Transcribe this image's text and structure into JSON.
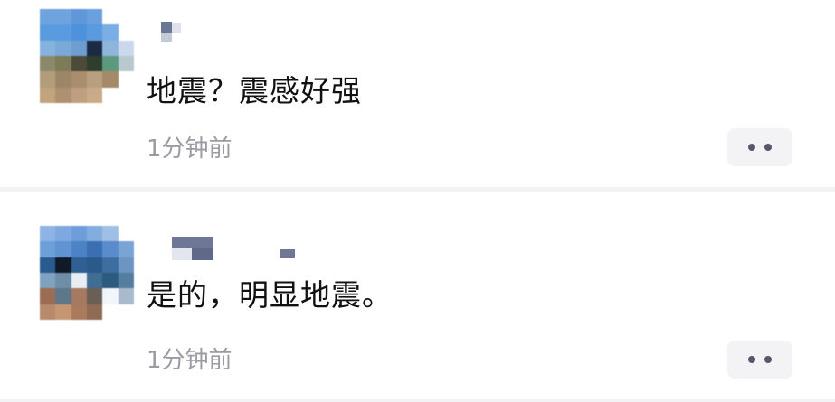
{
  "posts": [
    {
      "text": "地震？震感好强",
      "time": "1分钟前",
      "more_icon": "more-dots-icon"
    },
    {
      "text": "是的，明显地震。",
      "time": "1分钟前",
      "more_icon": "more-dots-icon"
    }
  ]
}
